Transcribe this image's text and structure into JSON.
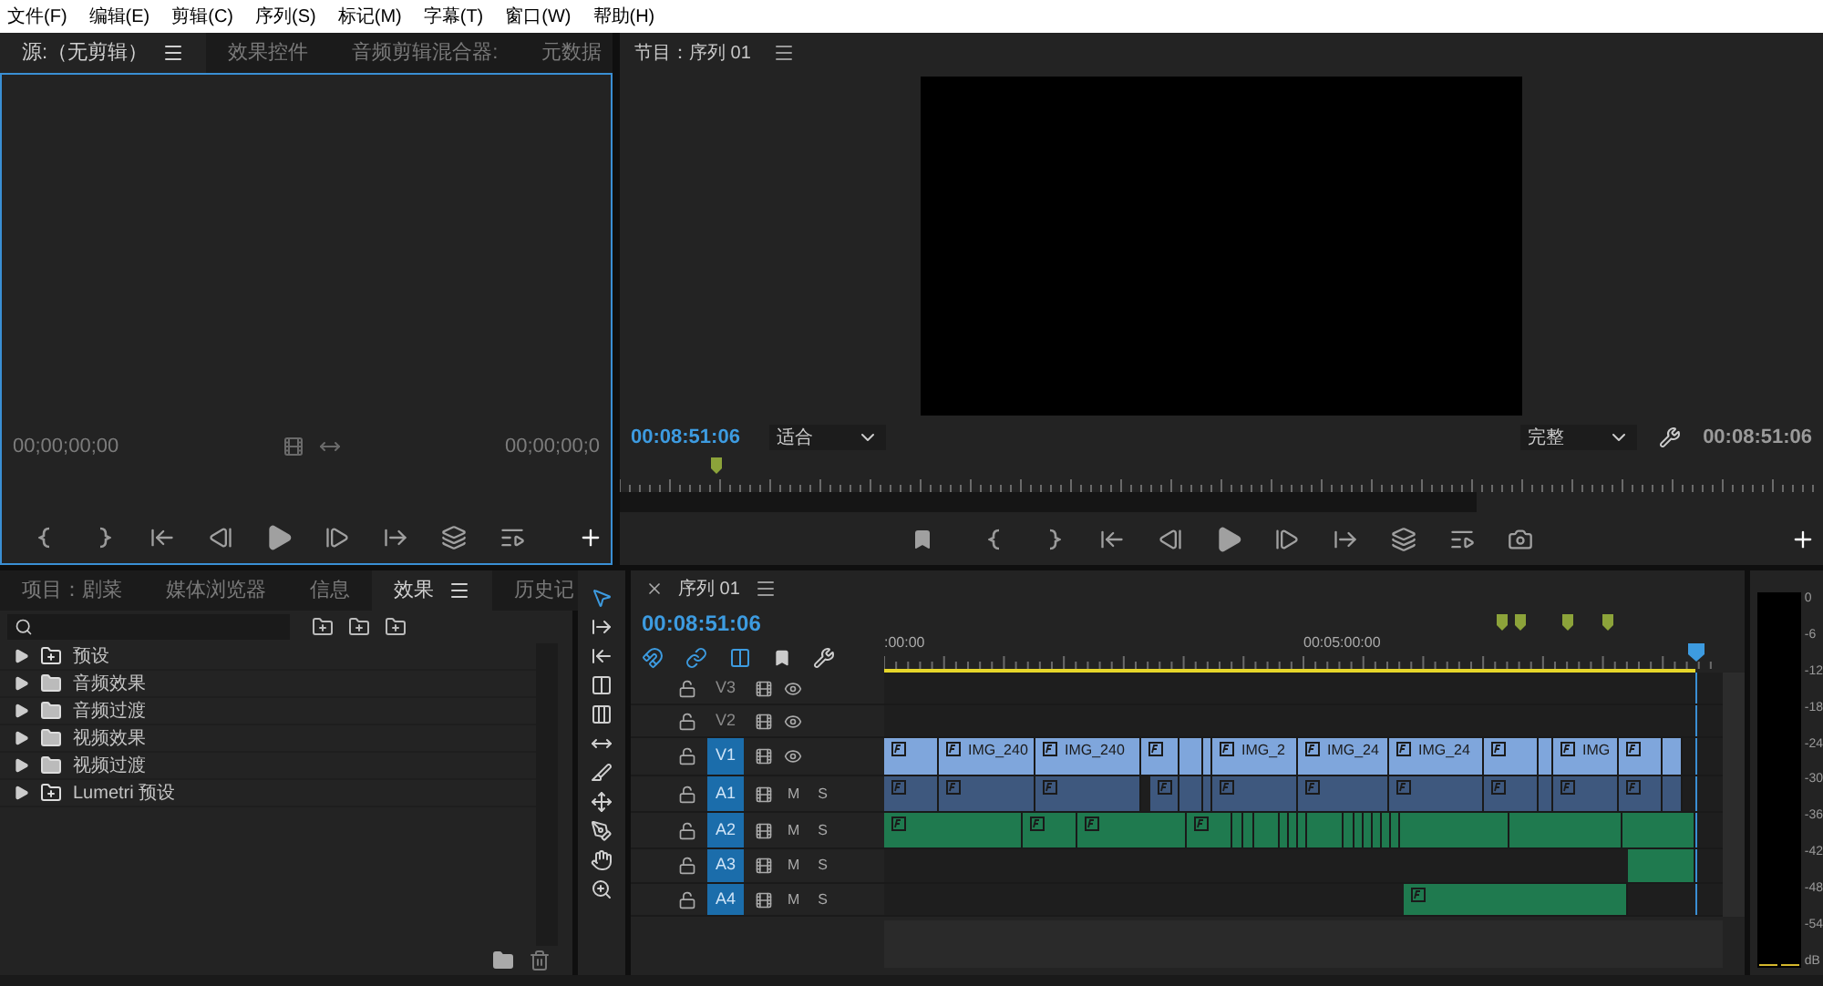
{
  "menu": [
    "文件(F)",
    "编辑(E)",
    "剪辑(C)",
    "序列(S)",
    "标记(M)",
    "字幕(T)",
    "窗口(W)",
    "帮助(H)"
  ],
  "source": {
    "tabs": [
      {
        "label": "源:（无剪辑）",
        "selected": true
      },
      {
        "label": "效果控件",
        "selected": false
      },
      {
        "label": "音频剪辑混合器:",
        "selected": false
      },
      {
        "label": "元数据",
        "selected": false
      }
    ],
    "timecode_in": "00;00;00;00",
    "timecode_out": "00;00;00;0"
  },
  "program": {
    "title": "节目：序列 01",
    "timecode": "00:08:51:06",
    "zoom": "适合",
    "quality": "完整",
    "duration": "00:08:51:06"
  },
  "effects_panel": {
    "tabs": [
      {
        "label": "项目：剧菜",
        "selected": false
      },
      {
        "label": "媒体浏览器",
        "selected": false
      },
      {
        "label": "信息",
        "selected": false
      },
      {
        "label": "效果",
        "selected": true
      },
      {
        "label": "历史记",
        "selected": false
      }
    ],
    "items": [
      {
        "kind": "preset",
        "label": "预设",
        "expanded": false
      },
      {
        "kind": "folder",
        "label": "音频效果",
        "expanded": false
      },
      {
        "kind": "folder",
        "label": "音频过渡",
        "expanded": false
      },
      {
        "kind": "folder",
        "label": "视频效果",
        "expanded": false
      },
      {
        "kind": "folder",
        "label": "视频过渡",
        "expanded": false
      },
      {
        "kind": "preset",
        "label": "Lumetri 预设",
        "expanded": false
      }
    ]
  },
  "tools": [
    {
      "selected": true
    },
    {
      "selected": false
    },
    {
      "selected": false
    },
    {
      "selected": false
    },
    {
      "selected": false
    },
    {
      "selected": false
    },
    {
      "selected": false
    },
    {
      "selected": false
    },
    {
      "selected": false
    },
    {
      "selected": false
    },
    {
      "selected": false
    }
  ],
  "timeline": {
    "tab": "序列 01",
    "timecode": "00:08:51:06",
    "ruler_labels": [
      ":00:00",
      "00:05:00:00"
    ],
    "tracks": [
      {
        "kind": "video",
        "name": "V3",
        "targeted": false
      },
      {
        "kind": "video",
        "name": "V2",
        "targeted": false
      },
      {
        "kind": "video",
        "name": "V1",
        "targeted": true,
        "color": "#7fa6dc",
        "clips": [
          {
            "kind": "clip",
            "fx": true
          },
          {
            "kind": "clip",
            "fx": true,
            "label": "IMG_240"
          },
          {
            "kind": "clip",
            "fx": true,
            "label": "IMG_240"
          },
          {
            "kind": "clip",
            "fx": true
          },
          {
            "kind": "clip",
            "fx": false
          },
          {
            "kind": "clip"
          },
          {
            "kind": "clip",
            "fx": true,
            "label": "IMG_2"
          },
          {
            "kind": "clip",
            "fx": true,
            "label": "IMG_24"
          },
          {
            "kind": "clip",
            "fx": true,
            "label": "IMG_24"
          },
          {
            "kind": "clip",
            "fx": true
          },
          {
            "kind": "clip",
            "fx": false
          },
          {
            "kind": "clip",
            "fx": true,
            "label": "IMG"
          },
          {
            "kind": "clip",
            "fx": true
          },
          {
            "kind": "clip",
            "fx": false
          }
        ]
      },
      {
        "kind": "audio",
        "name": "A1",
        "targeted": true,
        "mute": "M",
        "solo": "S",
        "color": "#3e587e",
        "clips": [
          {
            "kind": "clip",
            "fx": true
          },
          {
            "kind": "clip",
            "fx": true
          },
          {
            "kind": "clip",
            "fx": true
          },
          {
            "kind": "gap"
          },
          {
            "kind": "clip",
            "fx": true
          },
          {
            "kind": "clip",
            "fx": false
          },
          {
            "kind": "clip"
          },
          {
            "kind": "clip",
            "fx": true
          },
          {
            "kind": "clip",
            "fx": true
          },
          {
            "kind": "clip",
            "fx": true
          },
          {
            "kind": "clip",
            "fx": true
          },
          {
            "kind": "clip",
            "fx": false
          },
          {
            "kind": "clip",
            "fx": true
          },
          {
            "kind": "clip",
            "fx": true
          },
          {
            "kind": "clip",
            "fx": false
          }
        ]
      },
      {
        "kind": "audio",
        "name": "A2",
        "targeted": true,
        "mute": "M",
        "solo": "S",
        "color": "#1f7a4f",
        "clips": [
          {
            "kind": "clip",
            "fx": true
          },
          {
            "kind": "clip",
            "fx": true
          },
          {
            "kind": "clip",
            "fx": true
          },
          {
            "kind": "clip",
            "fx": true
          },
          {
            "kind": "clip",
            "fx": false
          },
          {
            "kind": "clip",
            "fx": false
          },
          {
            "kind": "clip",
            "fx": false
          },
          {
            "kind": "clip"
          },
          {
            "kind": "clip"
          },
          {
            "kind": "clip"
          },
          {
            "kind": "clip",
            "fx": false
          },
          {
            "kind": "clip",
            "fx": false
          },
          {
            "kind": "clip"
          },
          {
            "kind": "clip"
          },
          {
            "kind": "clip"
          },
          {
            "kind": "clip"
          },
          {
            "kind": "clip"
          },
          {
            "kind": "clip",
            "fx": false
          },
          {
            "kind": "clip",
            "fx": false
          },
          {
            "kind": "clip",
            "fx": false
          }
        ]
      },
      {
        "kind": "audio",
        "name": "A3",
        "targeted": true,
        "mute": "M",
        "solo": "S",
        "color": "#1f7a4f",
        "clips": [
          {
            "kind": "gap"
          },
          {
            "kind": "clip",
            "fx": false
          }
        ]
      },
      {
        "kind": "audio",
        "name": "A4",
        "targeted": true,
        "mute": "M",
        "solo": "S",
        "color": "#1f7a4f",
        "clips": [
          {
            "kind": "gap"
          },
          {
            "kind": "clip",
            "fx": true
          }
        ]
      }
    ]
  },
  "meter": {
    "scale": [
      "0",
      "-6",
      "-12",
      "-18",
      "-24",
      "-30",
      "-36",
      "-42",
      "-48",
      "-54",
      "dB"
    ]
  }
}
